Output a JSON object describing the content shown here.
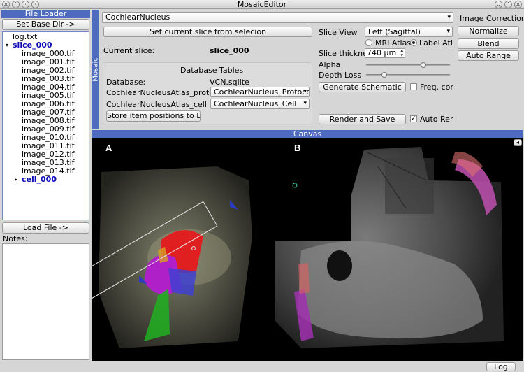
{
  "window": {
    "title": "MosaicEditor"
  },
  "file_loader": {
    "header": "File Loader",
    "set_base_dir": "Set Base Dir ->",
    "tree": [
      {
        "label": "log.txt",
        "level": 0,
        "bold": false
      },
      {
        "label": "slice_000",
        "level": 0,
        "bold": true,
        "expanded": true
      },
      {
        "label": "image_000.tif",
        "level": 1
      },
      {
        "label": "image_001.tif",
        "level": 1
      },
      {
        "label": "image_002.tif",
        "level": 1
      },
      {
        "label": "image_003.tif",
        "level": 1
      },
      {
        "label": "image_004.tif",
        "level": 1
      },
      {
        "label": "image_005.tif",
        "level": 1
      },
      {
        "label": "image_006.tif",
        "level": 1
      },
      {
        "label": "image_007.tif",
        "level": 1
      },
      {
        "label": "image_008.tif",
        "level": 1
      },
      {
        "label": "image_009.tif",
        "level": 1
      },
      {
        "label": "image_010.tif",
        "level": 1
      },
      {
        "label": "image_011.tif",
        "level": 1
      },
      {
        "label": "image_012.tif",
        "level": 1
      },
      {
        "label": "image_013.tif",
        "level": 1
      },
      {
        "label": "image_014.tif",
        "level": 1
      },
      {
        "label": "cell_000",
        "level": 1,
        "bold": true
      }
    ],
    "load_file": "Load File ->",
    "notes_label": "Notes:"
  },
  "mosaic": {
    "side_label": "Mosaic",
    "atlas_select": "CochlearNucleus",
    "set_slice_button": "Set current slice from selecion",
    "current_slice_label": "Current slice:",
    "current_slice_value": "slice_000",
    "db_tables": {
      "title": "Database Tables",
      "database_label": "Database:",
      "database_value": "VCN.sqlite",
      "rows": [
        {
          "label": "CochlearNucleusAtlas_protocol",
          "value": "CochlearNucleus_Protocol"
        },
        {
          "label": "CochlearNucleusAtlas_cell",
          "value": "CochlearNucleus_Cell"
        }
      ],
      "store_button": "Store item positions to DB"
    },
    "slice_view_label": "Slice View",
    "slice_view_value": "Left (Sagittal)",
    "mri_atlas": "MRI Atlas",
    "label_atlas": "Label Atlas",
    "thickness_label": "Slice thicknes",
    "thickness_value": "740 µm",
    "alpha_label": "Alpha",
    "alpha_level": 0.7,
    "depth_loss_label": "Depth Loss",
    "depth_loss_level": 0.2,
    "generate_button": "Generate Schematic",
    "freq_label": "Freq. conto",
    "render_button": "Render and Save",
    "auto_render_label": "Auto Rend"
  },
  "image_correction": {
    "title": "Image Correction",
    "normalize": "Normalize",
    "blend": "Blend",
    "auto_range": "Auto Range"
  },
  "canvas": {
    "header": "Canvas",
    "panel_a": "A",
    "panel_b": "B"
  },
  "statusbar": {
    "log_button": "Log"
  }
}
